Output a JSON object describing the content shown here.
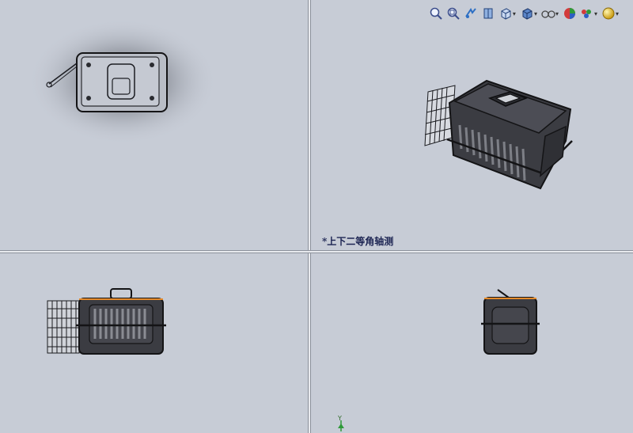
{
  "toolbar": {
    "buttons": [
      {
        "name": "zoom-to-fit-icon"
      },
      {
        "name": "zoom-to-area-icon"
      },
      {
        "name": "previous-view-icon"
      },
      {
        "name": "section-view-icon"
      },
      {
        "name": "view-orientation-icon",
        "dropdown": true
      },
      {
        "name": "display-style-icon",
        "dropdown": true
      },
      {
        "name": "hide-show-items-icon",
        "dropdown": true
      },
      {
        "name": "edit-appearance-icon"
      },
      {
        "name": "apply-scene-icon",
        "dropdown": true
      },
      {
        "name": "view-settings-icon",
        "dropdown": true
      }
    ],
    "caret": "▾"
  },
  "viewports": {
    "top_right": {
      "label": "*上下二等角轴测"
    }
  },
  "triad": {
    "axis_label": "Y"
  },
  "colors": {
    "background": "#c7ccd6",
    "model_body": "#3b3c42",
    "model_edge": "#141416",
    "accent_orange": "#e58a2a",
    "label": "#1c2452"
  }
}
